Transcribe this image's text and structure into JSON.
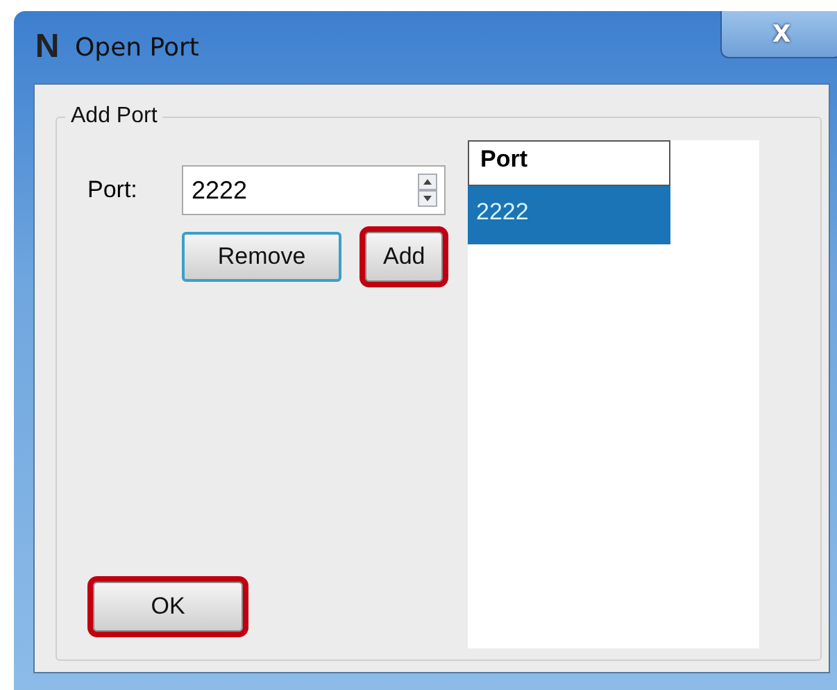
{
  "window": {
    "app_icon": "N",
    "title": "Open Port",
    "close": "X"
  },
  "group": {
    "title": "Add Port",
    "port_field": {
      "label": "Port:",
      "value": "2222"
    },
    "buttons": [
      {
        "label": "Remove",
        "highlighted": false,
        "focused": true
      },
      {
        "label": "Add",
        "highlighted": true,
        "focused": false
      }
    ],
    "list": {
      "columns": [
        "Port"
      ],
      "rows": [
        {
          "cells": [
            "2222"
          ],
          "selected": true
        }
      ]
    }
  },
  "ok_button": {
    "label": "OK",
    "highlighted": true
  }
}
